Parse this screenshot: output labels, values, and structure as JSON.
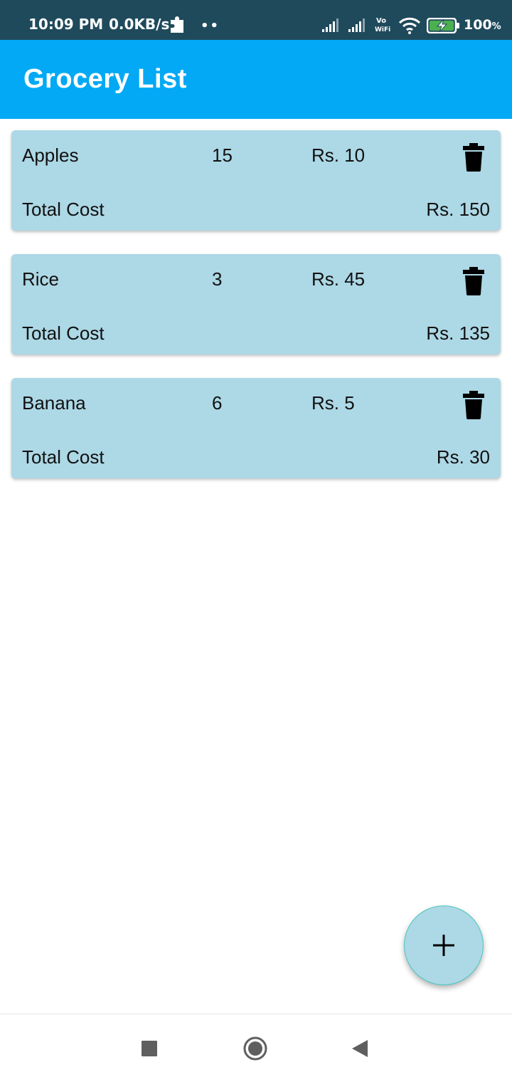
{
  "status_bar": {
    "time": "10:09 PM",
    "speed": "0.0KB/s",
    "dots": "••",
    "battery_value": "100",
    "battery_unit": "%",
    "vowifi_top": "Vo",
    "vowifi_bottom": "WiFi",
    "icons": [
      "puzzle-icon",
      "signal-icon",
      "signal-icon",
      "vowifi-icon",
      "wifi-icon",
      "battery-charging-icon"
    ]
  },
  "app_bar": {
    "title": "Grocery List",
    "color": "#03a9f4"
  },
  "items": [
    {
      "name": "Apples",
      "quantity": "15",
      "price": "Rs. 10",
      "total_label": "Total Cost",
      "total": "Rs. 150"
    },
    {
      "name": "Rice",
      "quantity": "3",
      "price": "Rs. 45",
      "total_label": "Total Cost",
      "total": "Rs. 135"
    },
    {
      "name": "Banana",
      "quantity": "6",
      "price": "Rs. 5",
      "total_label": "Total Cost",
      "total": "Rs. 30"
    }
  ],
  "card_color": "#add8e6",
  "fab": {
    "icon": "plus-icon"
  },
  "nav": {
    "icons": [
      "recents-icon",
      "home-icon",
      "back-icon"
    ]
  }
}
